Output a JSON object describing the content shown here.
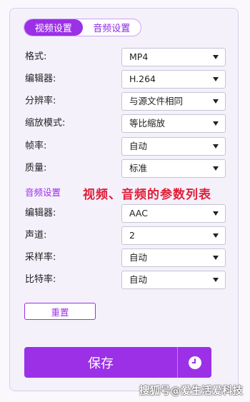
{
  "tabs": [
    {
      "label": "视频设置",
      "active": true
    },
    {
      "label": "音频设置",
      "active": false
    }
  ],
  "video_settings": [
    {
      "label": "格式:",
      "value": "MP4"
    },
    {
      "label": "编辑器:",
      "value": "H.264"
    },
    {
      "label": "分辨率:",
      "value": "与源文件相同"
    },
    {
      "label": "缩放模式:",
      "value": "等比缩放"
    },
    {
      "label": "帧率:",
      "value": "自动"
    },
    {
      "label": "质量:",
      "value": "标准"
    }
  ],
  "audio_section_title": "音频设置",
  "annotation": "视频、音频的参数列表",
  "audio_settings": [
    {
      "label": "编辑器:",
      "value": "AAC"
    },
    {
      "label": "声道:",
      "value": "2"
    },
    {
      "label": "采样率:",
      "value": "自动"
    },
    {
      "label": "比特率:",
      "value": "自动"
    }
  ],
  "reset_label": "重置",
  "save_label": "保存",
  "watermark": "搜狐号@爱生活爱科技",
  "colors": {
    "accent": "#9b30e6",
    "annotation": "#e0203a"
  },
  "icons": {
    "dropdown": "caret-down-icon",
    "schedule": "clock-icon"
  }
}
